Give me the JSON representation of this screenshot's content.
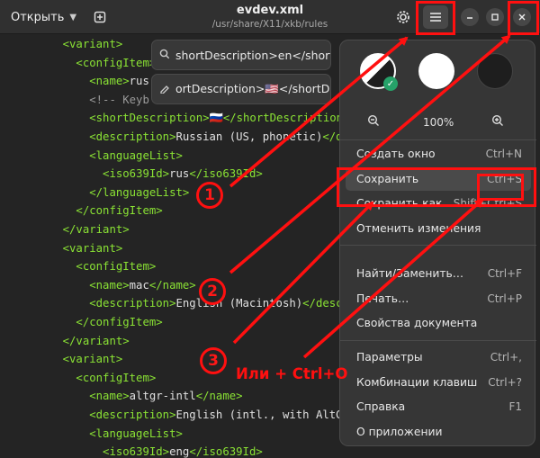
{
  "header": {
    "open_label": "Открыть",
    "title": "evdev.xml",
    "subtitle": "/usr/share/X11/xkb/rules",
    "icons": {
      "chevron": "chevron-down-icon",
      "newtab": "new-tab-icon",
      "gear": "gear-icon",
      "menu": "hamburger-menu-icon",
      "minimize": "minimize-icon",
      "maximize": "maximize-icon",
      "close": "close-icon"
    }
  },
  "editor": {
    "lines": [
      {
        "indent": "    ",
        "parts": [
          [
            "tag",
            "<variant>"
          ]
        ]
      },
      {
        "indent": "      ",
        "parts": [
          [
            "tag",
            "<configItem>"
          ]
        ]
      },
      {
        "indent": "        ",
        "parts": [
          [
            "tag",
            "<name>"
          ],
          [
            "txt",
            "rus"
          ]
        ]
      },
      {
        "indent": "        ",
        "parts": [
          [
            "com",
            "<!-- Keyb"
          ]
        ]
      },
      {
        "indent": "        ",
        "parts": [
          [
            "tag",
            "<shortDescription>"
          ],
          [
            "txt",
            "🇷🇺"
          ],
          [
            "tag",
            "</shortDescription>"
          ]
        ]
      },
      {
        "indent": "        ",
        "parts": [
          [
            "tag",
            "<description>"
          ],
          [
            "txt",
            "Russian (US, phonetic)"
          ],
          [
            "tag",
            "</description>"
          ]
        ]
      },
      {
        "indent": "        ",
        "parts": [
          [
            "tag",
            "<languageList>"
          ]
        ]
      },
      {
        "indent": "          ",
        "parts": [
          [
            "tag",
            "<iso639Id>"
          ],
          [
            "txt",
            "rus"
          ],
          [
            "tag",
            "</iso639Id>"
          ]
        ]
      },
      {
        "indent": "        ",
        "parts": [
          [
            "tag",
            "</languageList>"
          ]
        ]
      },
      {
        "indent": "      ",
        "parts": [
          [
            "tag",
            "</configItem>"
          ]
        ]
      },
      {
        "indent": "    ",
        "parts": [
          [
            "tag",
            "</variant>"
          ]
        ]
      },
      {
        "indent": "    ",
        "parts": [
          [
            "tag",
            "<variant>"
          ]
        ]
      },
      {
        "indent": "      ",
        "parts": [
          [
            "tag",
            "<configItem>"
          ]
        ]
      },
      {
        "indent": "        ",
        "parts": [
          [
            "tag",
            "<name>"
          ],
          [
            "txt",
            "mac"
          ],
          [
            "tag",
            "</name>"
          ]
        ]
      },
      {
        "indent": "        ",
        "parts": [
          [
            "tag",
            "<description>"
          ],
          [
            "txt",
            "English (Macintosh)"
          ],
          [
            "tag",
            "</description>"
          ]
        ]
      },
      {
        "indent": "      ",
        "parts": [
          [
            "tag",
            "</configItem>"
          ]
        ]
      },
      {
        "indent": "    ",
        "parts": [
          [
            "tag",
            "</variant>"
          ]
        ]
      },
      {
        "indent": "    ",
        "parts": [
          [
            "tag",
            "<variant>"
          ]
        ]
      },
      {
        "indent": "      ",
        "parts": [
          [
            "tag",
            "<configItem>"
          ]
        ]
      },
      {
        "indent": "        ",
        "parts": [
          [
            "tag",
            "<name>"
          ],
          [
            "txt",
            "altgr-intl"
          ],
          [
            "tag",
            "</name>"
          ]
        ]
      },
      {
        "indent": "        ",
        "parts": [
          [
            "tag",
            "<description>"
          ],
          [
            "txt",
            "English (intl., with AltGr dead keys)"
          ],
          [
            "tag",
            "</description>"
          ]
        ]
      },
      {
        "indent": "        ",
        "parts": [
          [
            "tag",
            "<languageList>"
          ]
        ]
      },
      {
        "indent": "          ",
        "parts": [
          [
            "tag",
            "<iso639Id>"
          ],
          [
            "txt",
            "eng"
          ],
          [
            "tag",
            "</iso639Id>"
          ]
        ]
      }
    ]
  },
  "search_popovers": [
    {
      "icon": "search-icon",
      "text": "shortDescription>en</short"
    },
    {
      "icon": "replace-icon",
      "text": "ortDescription>🇺🇸</shortDe"
    }
  ],
  "menu": {
    "zoom": {
      "out_icon": "zoom-out-icon",
      "level": "100%",
      "in_icon": "zoom-in-icon"
    },
    "style_schemes": [
      "system",
      "light",
      "dark"
    ],
    "colors": {
      "light": "#ffffff",
      "dark": "#1e1e1e",
      "selected_check": "#26a269"
    },
    "groups": [
      [
        {
          "label": "Создать окно",
          "accel": "Ctrl+N"
        },
        {
          "label": "Сохранить",
          "accel": "Ctrl+S",
          "highlighted": true
        },
        {
          "label": "Сохранить как…",
          "accel": "Shift+Ctrl+S"
        },
        {
          "label": "Отменить изменения",
          "accel": ""
        }
      ],
      [
        {
          "label": "Найти/Заменить…",
          "accel": "Ctrl+F"
        },
        {
          "label": "Печать…",
          "accel": "Ctrl+P"
        },
        {
          "label": "Свойства документа",
          "accel": ""
        }
      ],
      [
        {
          "label": "Параметры",
          "accel": "Ctrl+,"
        },
        {
          "label": "Комбинации клавиш",
          "accel": "Ctrl+?"
        },
        {
          "label": "Справка",
          "accel": "F1"
        },
        {
          "label": "О приложении",
          "accel": ""
        }
      ]
    ]
  },
  "annotations": {
    "color": "#ff1010",
    "steps": [
      "1",
      "2",
      "3"
    ],
    "note": "Или + Ctrl+O"
  }
}
